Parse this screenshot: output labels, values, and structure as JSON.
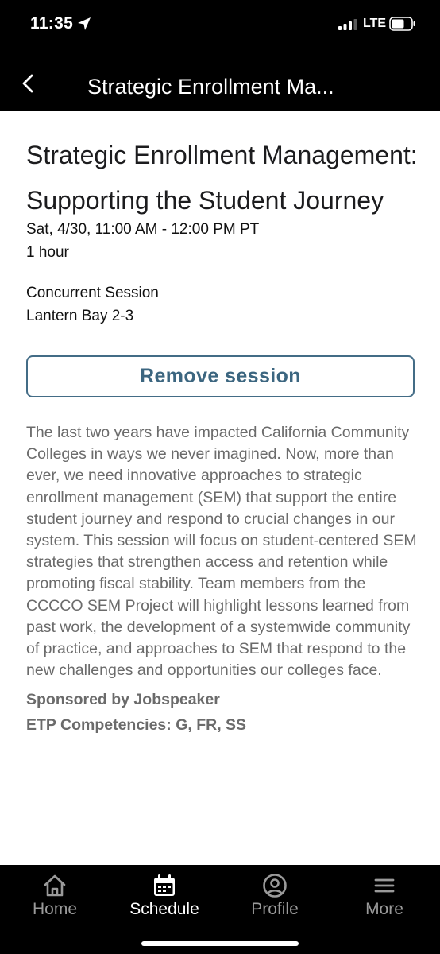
{
  "status_bar": {
    "time": "11:35",
    "network": "LTE",
    "icons": [
      "location-arrow-icon",
      "signal-bars-icon",
      "battery-icon"
    ]
  },
  "header": {
    "back_icon": "chevron-left-icon",
    "title": "Strategic Enrollment Ma..."
  },
  "session": {
    "title": "Strategic Enrollment Management: Supporting the Student Journey",
    "datetime": "Sat, 4/30, 11:00 AM - 12:00 PM PT",
    "duration": "1 hour",
    "type": "Concurrent Session",
    "location": "Lantern Bay 2-3",
    "action_label": "Remove session",
    "description": "The last two years have impacted California Community Colleges in ways we never imagined. Now, more than ever, we need innovative approaches to strategic enrollment management (SEM) that support the entire student journey and respond to crucial changes in our system. This session will focus on student-centered SEM strategies that strengthen access and retention while promoting fiscal stability. Team members from the CCCCO SEM Project will highlight lessons learned from past work, the development of a systemwide community of practice, and approaches to SEM that respond to the new challenges and opportunities our colleges face.",
    "sponsor": "Sponsored by Jobspeaker",
    "competencies": "ETP Competencies: G, FR, SS"
  },
  "tabs": [
    {
      "label": "Home",
      "icon": "home-icon",
      "active": false
    },
    {
      "label": "Schedule",
      "icon": "calendar-icon",
      "active": true
    },
    {
      "label": "Profile",
      "icon": "user-circle-icon",
      "active": false
    },
    {
      "label": "More",
      "icon": "menu-icon",
      "active": false
    }
  ],
  "colors": {
    "header_bg": "#000000",
    "accent": "#3c6680",
    "body_text": "#6b6b6b",
    "tab_active": "#ffffff",
    "tab_inactive": "#9a9a9a"
  }
}
